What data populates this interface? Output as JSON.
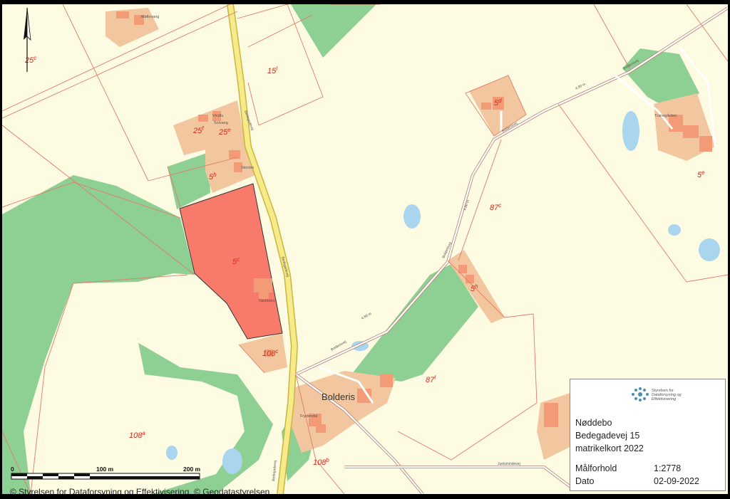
{
  "map": {
    "place_name": "Bolderis",
    "small_places": [
      "Møllevang",
      "Vindtu",
      "Solvang",
      "Skovbo",
      "Nøddebo",
      "Frydendal",
      "Tranegården"
    ],
    "road_labels": [
      "Bedegadevej",
      "Bedegadevej",
      "Bolderisvej",
      "Bolderisvej",
      "Bolderisvej",
      "Bolderisvej",
      "Juelsmindevej",
      "Bedegadevej"
    ],
    "road_distance_labels": [
      "4.80 m",
      "4.80 m",
      "4.80 m"
    ],
    "parcels": [
      {
        "num": "25",
        "letter": "c"
      },
      {
        "num": "15",
        "letter": "l"
      },
      {
        "num": "25",
        "letter": "f"
      },
      {
        "num": "25",
        "letter": "e"
      },
      {
        "num": "5",
        "letter": "b"
      },
      {
        "num": "5",
        "letter": "c"
      },
      {
        "num": "108",
        "letter": "c"
      },
      {
        "num": "108",
        "letter": "a"
      },
      {
        "num": "108",
        "letter": "b"
      },
      {
        "num": "5",
        "letter": "d"
      },
      {
        "num": "5",
        "letter": "e"
      },
      {
        "num": "87",
        "letter": "c"
      },
      {
        "num": "5",
        "letter": "h"
      },
      {
        "num": "87",
        "letter": "l"
      }
    ],
    "highlighted_parcel": "5c",
    "north_arrow": "north-arrow-icon"
  },
  "scalebar": {
    "labels": [
      "0",
      "100 m",
      "200 m"
    ]
  },
  "info": {
    "logo_text_1": "Styrelsen for",
    "logo_text_2": "Dataforsyning og",
    "logo_text_3": "Effektivisering",
    "title": "Nøddebo",
    "address": "Bedegadevej 15",
    "map_type": "matrikelkort 2022",
    "scale_label": "Målforhold",
    "scale_value": "1:2778",
    "date_label": "Dato",
    "date_value": "02-09-2022"
  },
  "copyright": "© Styrelsen for Dataforsyning og Effektivisering, © Geodatastyrelsen",
  "colors": {
    "background": "#fdfbe2",
    "forest": "#8ecf93",
    "built": "#f2c7a0",
    "building": "#f39a76",
    "highlight": "#f77a6a",
    "road": "#f6ea8a",
    "water": "#a9d5ef",
    "parcel_line": "#e07a6a"
  }
}
